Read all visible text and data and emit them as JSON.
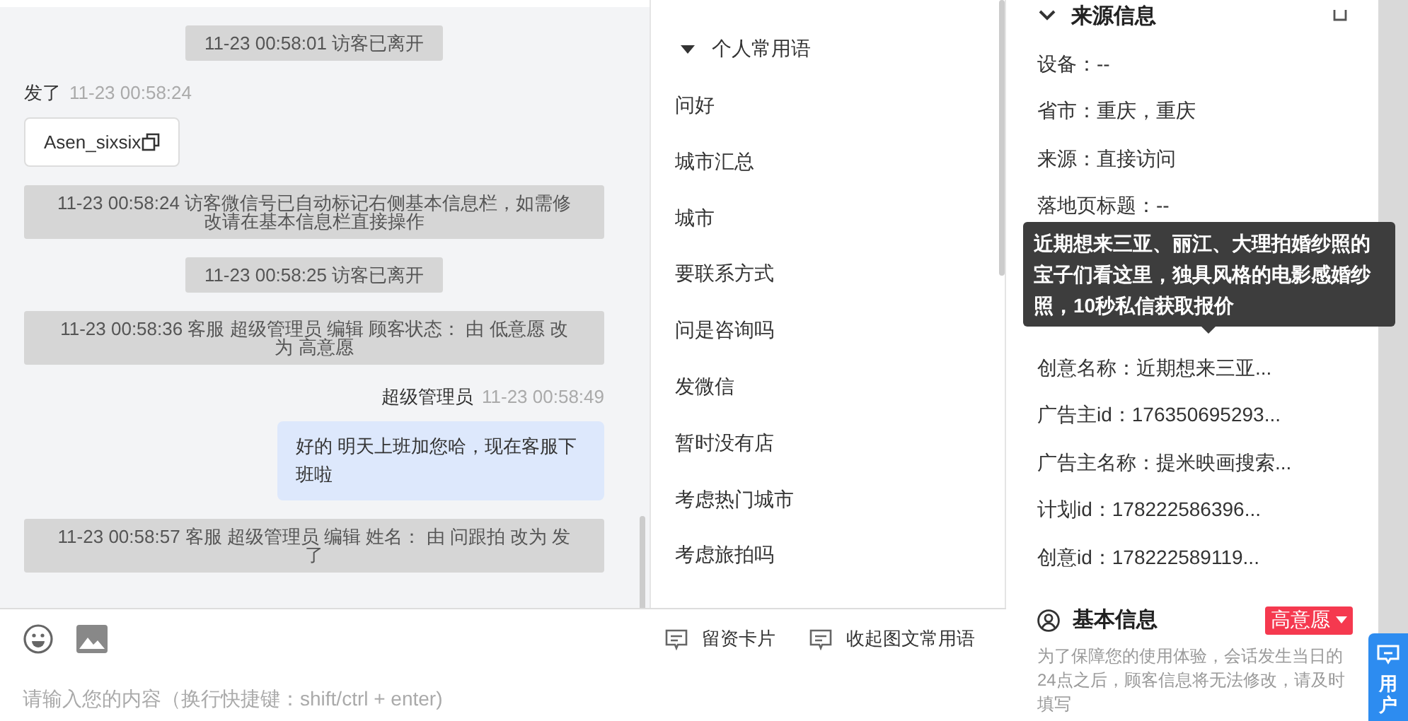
{
  "chat": {
    "messages": [
      {
        "kind": "system",
        "text": "11-23 00:58:01 访客已离开"
      },
      {
        "kind": "visitor",
        "sender": "发了",
        "time": "11-23 00:58:24",
        "text": "Asen_sixsix"
      },
      {
        "kind": "system",
        "text": "11-23 00:58:24 访客微信号已自动标记右侧基本信息栏，如需修改请在基本信息栏直接操作"
      },
      {
        "kind": "system",
        "text": "11-23 00:58:25 访客已离开"
      },
      {
        "kind": "system",
        "text": "11-23 00:58:36 客服 超级管理员 编辑 顾客状态： 由 低意愿 改为 高意愿"
      },
      {
        "kind": "agent",
        "sender": "超级管理员",
        "time": "11-23 00:58:49",
        "text": "好的 明天上班加您哈，现在客服下班啦"
      },
      {
        "kind": "system",
        "text": "11-23 00:58:57 客服 超级管理员 编辑 姓名： 由 问跟拍 改为 发了"
      }
    ]
  },
  "phrases": {
    "group": {
      "label": "个人常用语",
      "expanded": true
    },
    "items": [
      "问好",
      "城市汇总",
      "城市",
      "要联系方式",
      "问是咨询吗",
      "发微信",
      "暂时没有店",
      "考虑热门城市",
      "考虑旅拍吗"
    ]
  },
  "composer": {
    "placeholder": "请输入您的内容（换行快捷键：shift/ctrl + enter)",
    "actions": [
      "留资卡片",
      "收起图文常用语"
    ]
  },
  "source_info": {
    "title": "来源信息",
    "fields": [
      {
        "kind": "field",
        "text": "设备：--"
      },
      {
        "kind": "field",
        "text": "省市：重庆，重庆"
      },
      {
        "kind": "field",
        "text": "来源：直接访问"
      },
      {
        "kind": "field",
        "text": "落地页标题：--"
      },
      {
        "kind": "tooltip",
        "text": "近期想来三亚、丽江、大理拍婚纱照的宝子们看这里，独具风格的电影感婚纱照，10秒私信获取报价"
      },
      {
        "kind": "field",
        "text": "创意名称：近期想来三亚..."
      },
      {
        "kind": "field",
        "text": "广告主id：176350695293..."
      },
      {
        "kind": "field",
        "text": "广告主名称：提米映画搜索..."
      },
      {
        "kind": "field",
        "text": "计划id：178222586396..."
      },
      {
        "kind": "field",
        "text": "创意id：178222589119..."
      }
    ]
  },
  "basic_info": {
    "title": "基本信息",
    "intent_tag": {
      "label": "高意愿",
      "color": "#f5394f"
    },
    "notice": "为了保障您的使用体验，会话发生当日的24点之后，顾客信息将无法修改，请及时填写"
  },
  "float_button": {
    "label": "用户"
  }
}
